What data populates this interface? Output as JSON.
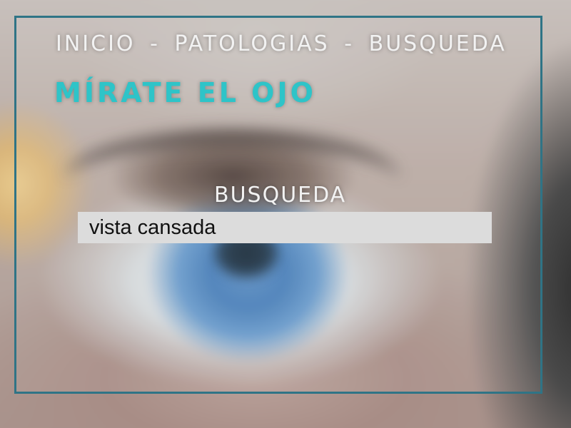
{
  "nav": {
    "breadcrumb": [
      {
        "label": "INICIO"
      },
      {
        "label": "PATOLOGIAS"
      },
      {
        "label": "BUSQUEDA"
      }
    ],
    "separator": "-"
  },
  "brand": {
    "title": "MÍRATE EL OJO",
    "color": "#2ec4c8"
  },
  "search": {
    "label": "BUSQUEDA",
    "value": "vista cansada"
  },
  "theme": {
    "frame_color": "#2f7486",
    "input_background": "#dcdcdc"
  },
  "background": {
    "icon": "blue-eye-photo"
  }
}
